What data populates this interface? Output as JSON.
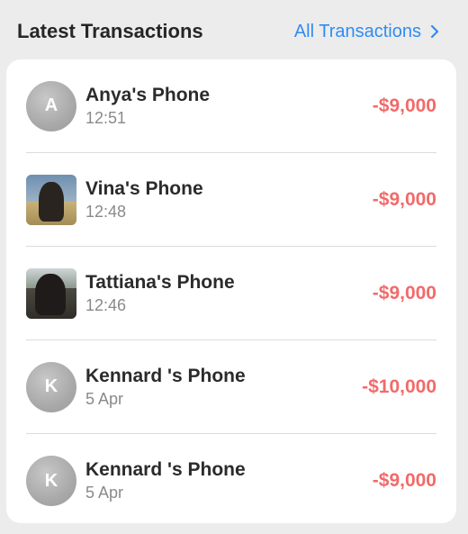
{
  "header": {
    "title": "Latest Transactions",
    "link_label": "All Transactions"
  },
  "transactions": [
    {
      "initial": "A",
      "name": "Anya's Phone",
      "time": "12:51",
      "amount": "-$9,000",
      "avatar": "initial"
    },
    {
      "initial": "",
      "name": "Vina's Phone",
      "time": "12:48",
      "amount": "-$9,000",
      "avatar": "photo"
    },
    {
      "initial": "",
      "name": "Tattiana's Phone",
      "time": "12:46",
      "amount": "-$9,000",
      "avatar": "photo"
    },
    {
      "initial": "K",
      "name": "Kennard 's Phone",
      "time": "5 Apr",
      "amount": "-$10,000",
      "avatar": "initial"
    },
    {
      "initial": "K",
      "name": "Kennard 's Phone",
      "time": "5 Apr",
      "amount": "-$9,000",
      "avatar": "initial"
    }
  ],
  "colors": {
    "accent": "#2f8cf3",
    "amount_negative": "#f26a6a"
  }
}
